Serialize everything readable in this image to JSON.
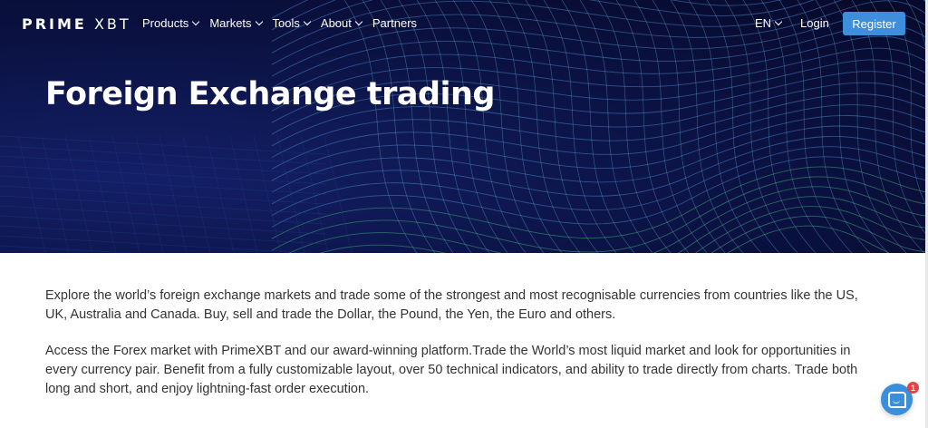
{
  "brand": {
    "logo_bold": "PRIME",
    "logo_light": "XBT"
  },
  "nav": {
    "items": [
      {
        "label": "Products",
        "dropdown": true
      },
      {
        "label": "Markets",
        "dropdown": true
      },
      {
        "label": "Tools",
        "dropdown": true
      },
      {
        "label": "About",
        "dropdown": true
      },
      {
        "label": "Partners",
        "dropdown": false
      }
    ],
    "language": "EN",
    "login": "Login",
    "register": "Register"
  },
  "hero": {
    "title": "Foreign Exchange trading"
  },
  "body": {
    "paragraph_1": "Explore the world’s foreign exchange markets and trade some of the strongest and most recognisable currencies from countries like the US, UK, Australia and Canada. Buy, sell and trade the Dollar, the Pound, the Yen, the Euro and others.",
    "paragraph_2": "Access the Forex market with PrimeXBT and our award-winning platform.Trade the World’s most liquid market and look for opportunities in every currency pair. Benefit from a fully customizable layout, over 50 technical indicators, and ability to trade directly from charts. Trade both long and short, and enjoy lightning-fast order execution."
  },
  "chat": {
    "unread_count": "1",
    "icon": "chat-icon"
  },
  "colors": {
    "hero_bg": "#0c1448",
    "accent": "#3d8fdd",
    "badge": "#e84142"
  }
}
